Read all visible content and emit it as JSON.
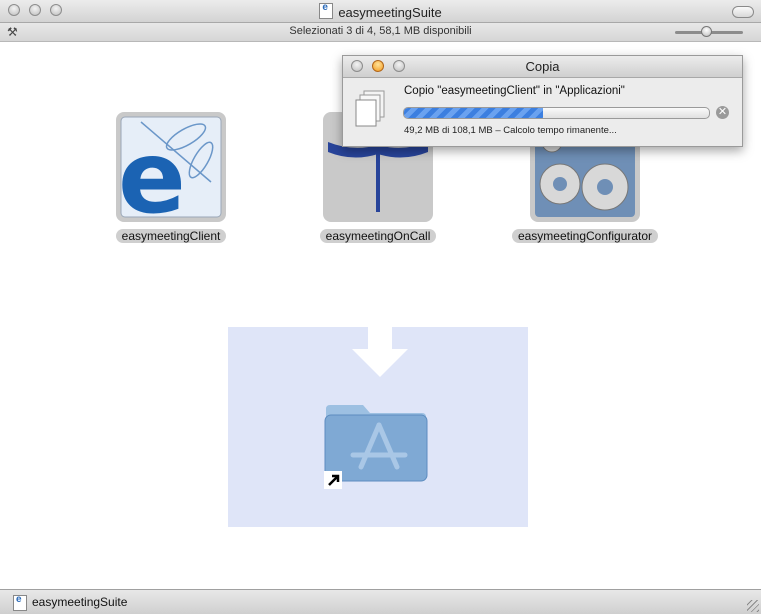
{
  "window": {
    "title": "easymeetingSuite",
    "info_text": "Selezionati 3 di 4, 58,1 MB disponibili"
  },
  "apps": [
    {
      "label": "easymeetingClient",
      "icon": "easymeeting-client-icon"
    },
    {
      "label": "easymeetingOnCall",
      "icon": "easymeeting-oncall-icon"
    },
    {
      "label": "easymeetingConfigurator",
      "icon": "easymeeting-configurator-icon"
    }
  ],
  "drop_target": {
    "icon": "applications-folder-icon"
  },
  "status_bar": {
    "label": "easymeetingSuite"
  },
  "copy_dialog": {
    "title": "Copia",
    "message": "Copio \"easymeetingClient\" in \"Applicazioni\"",
    "progress": 0.455,
    "status": "49,2 MB di 108,1 MB – Calcolo tempo rimanente..."
  },
  "colors": {
    "drop_zone": "#dfe5f8",
    "progress_blue": "#3c7fe0",
    "folder_blue": "#7fa9d4"
  }
}
